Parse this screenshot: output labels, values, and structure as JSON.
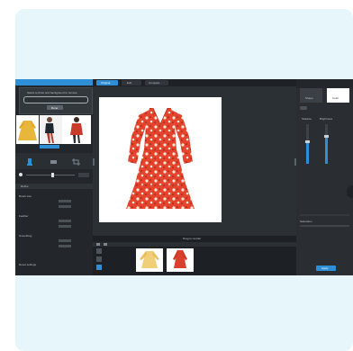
{
  "modal": {
    "message": "Select a photo and background to remove",
    "button": "Done"
  },
  "toolbar": {
    "left_title": "",
    "tabs": [
      "Original",
      "Edit",
      "Compare"
    ]
  },
  "left_panel": {
    "section1": "Refine",
    "labels": [
      "Brush size",
      "Feather",
      "Tolerance",
      "Smoothing",
      "Edge"
    ],
    "bottom_label": "Reset settings"
  },
  "center": {
    "bottom_label": "Drag to reorder"
  },
  "right_panel": {
    "tabs": [
      "Shape",
      "Color"
    ],
    "labels": [
      "Shadow",
      "Brightness",
      "Saturation"
    ],
    "apply": "Apply"
  },
  "colors": {
    "accent": "#2f8fd6",
    "dark": "#262a2e",
    "card": "#e6f6fa",
    "dress_red": "#e4442d"
  },
  "icons": [
    "brush-icon",
    "eraser-icon",
    "crop-icon",
    "image-icon",
    "grid-icon"
  ]
}
